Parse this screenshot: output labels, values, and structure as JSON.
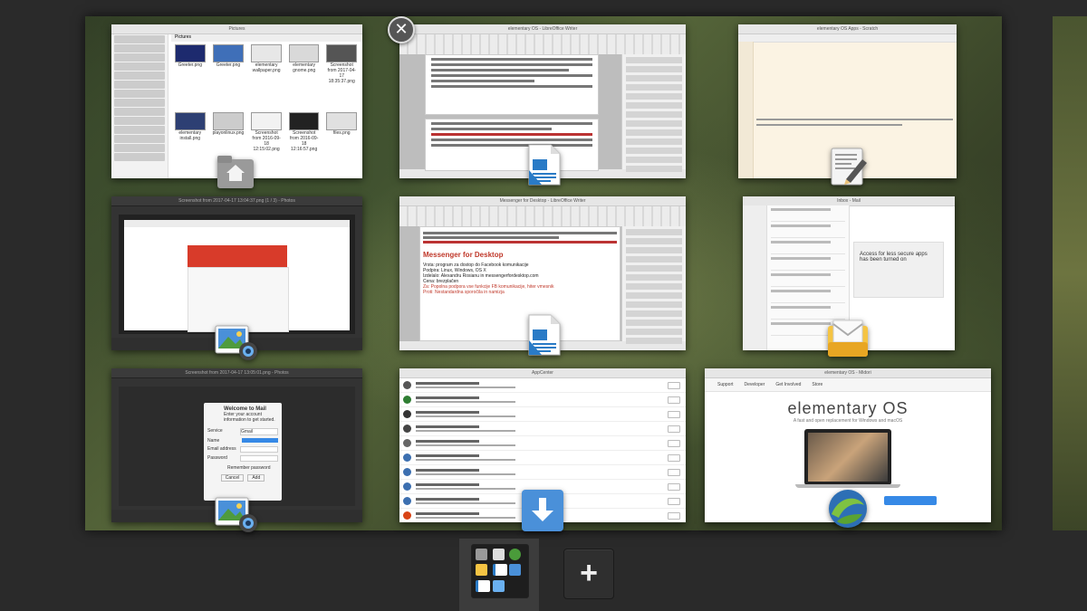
{
  "overview": {
    "close_label": "✕",
    "add_workspace_label": "+"
  },
  "windows": {
    "files": {
      "title": "Pictures",
      "path": "Pictures",
      "items": [
        "Greeter.png",
        "Greeter.png",
        "elementary wallpaper.png",
        "elementary gnome.png",
        "Screenshot from 2017-04-17 18:35:37.png",
        "elementary install.png",
        "playonlinux.png",
        "Screenshot from 2016-09-18 12:15:02.png",
        "Screenshot from 2016-09-18 12:16:57.png",
        "files.png"
      ]
    },
    "writer_top": {
      "title": "elementary OS - LibreOffice Writer"
    },
    "scratch": {
      "title": "elementary OS Apps - Scratch"
    },
    "photos_1": {
      "title": "Screenshot from 2017-04-17 13:04:37.png (1 / 3) - Photos"
    },
    "writer_mid": {
      "title": "Messenger for Desktop - LibreOffice Writer",
      "heading": "Messenger for Desktop",
      "lines": [
        "Vrsta: program za dostop do Facebook komunikacije",
        "Podpira: Linux, Windows, OS X",
        "Izdelalo: Alexandru Rosianu in messengerfordesktop.com",
        "Cena: brezplačen",
        "Za: Popolna podpora vse funkcije FB komunikacije, hiter vmesnik",
        "Proti: Nestandardna sporočila in namizja"
      ]
    },
    "mail": {
      "title": "Inbox - Mail",
      "banner": "Access for less secure apps has been turned on"
    },
    "photos_2": {
      "title": "Screenshot from 2017-04-17 13:05:01.png - Photos",
      "dialog_title": "Welcome to Mail",
      "dialog_sub": "Enter your account information to get started.",
      "fields": [
        "Service",
        "Name",
        "Email address",
        "Password"
      ],
      "service_value": "Gmail",
      "remember": "Remember password",
      "cancel": "Cancel",
      "add": "Add"
    },
    "appcenter": {
      "title": "AppCenter"
    },
    "browser": {
      "title": "elementary OS - Midori",
      "nav": [
        "Support",
        "Developer",
        "Get Involved",
        "Store"
      ],
      "heading": "elementary OS",
      "tagline": "A fast and open replacement for Windows and macOS"
    }
  },
  "colors": {
    "accent_blue": "#3689e6",
    "writer_blue": "#2a7bc6",
    "mail_yellow": "#f5c443",
    "download_blue": "#4a90d9"
  }
}
